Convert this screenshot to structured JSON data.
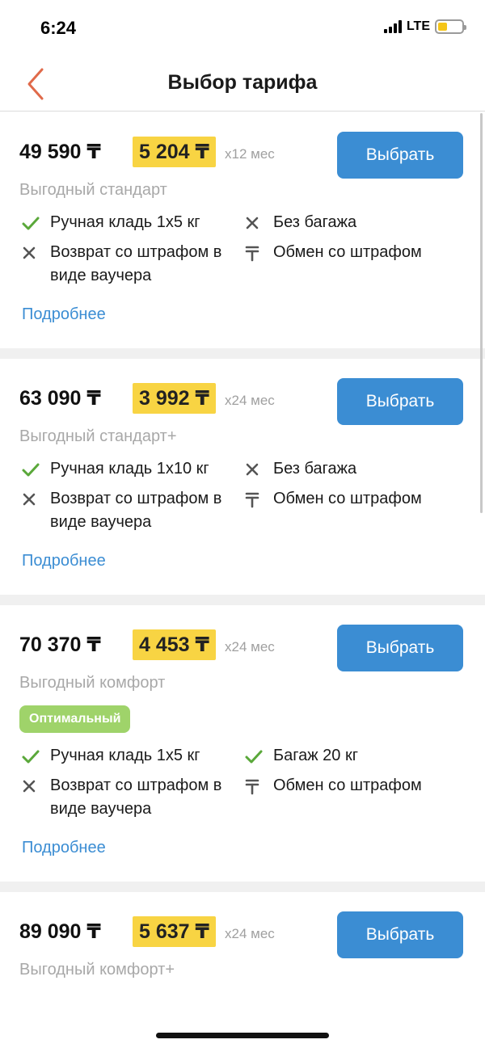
{
  "status": {
    "time": "6:24",
    "network": "LTE"
  },
  "header": {
    "title": "Выбор тарифа"
  },
  "tariffs": [
    {
      "price": "49 590 ₸",
      "monthly": "5 204 ₸",
      "term": "x12 мес",
      "name": "Выгодный стандарт",
      "badge": "",
      "select_label": "Выбрать",
      "features": [
        {
          "icon": "check-icon",
          "text": "Ручная кладь 1x5 кг"
        },
        {
          "icon": "cross-icon",
          "text": "Без багажа"
        },
        {
          "icon": "cross-icon",
          "text": "Возврат со штрафом в виде ваучера"
        },
        {
          "icon": "tenge-icon",
          "text": "Обмен со штрафом"
        }
      ],
      "more_label": "Подробнее"
    },
    {
      "price": "63 090 ₸",
      "monthly": "3 992 ₸",
      "term": "x24 мес",
      "name": "Выгодный стандарт+",
      "badge": "",
      "select_label": "Выбрать",
      "features": [
        {
          "icon": "check-icon",
          "text": "Ручная кладь 1x10 кг"
        },
        {
          "icon": "cross-icon",
          "text": "Без багажа"
        },
        {
          "icon": "cross-icon",
          "text": "Возврат со штрафом в виде ваучера"
        },
        {
          "icon": "tenge-icon",
          "text": "Обмен со штрафом"
        }
      ],
      "more_label": "Подробнее"
    },
    {
      "price": "70 370 ₸",
      "monthly": "4 453 ₸",
      "term": "x24 мес",
      "name": "Выгодный комфорт",
      "badge": "Оптимальный",
      "select_label": "Выбрать",
      "features": [
        {
          "icon": "check-icon",
          "text": "Ручная кладь 1x5 кг"
        },
        {
          "icon": "check-icon",
          "text": "Багаж 20 кг"
        },
        {
          "icon": "cross-icon",
          "text": "Возврат со штрафом в виде ваучера"
        },
        {
          "icon": "tenge-icon",
          "text": "Обмен со штрафом"
        }
      ],
      "more_label": "Подробнее"
    },
    {
      "price": "89 090 ₸",
      "monthly": "5 637 ₸",
      "term": "x24 мес",
      "name": "Выгодный комфорт+",
      "badge": "",
      "select_label": "Выбрать",
      "features": [],
      "more_label": ""
    }
  ],
  "colors": {
    "accent": "#3b8dd3",
    "highlight": "#f8d443",
    "badge": "#9fd36a",
    "check": "#5aa83a",
    "back_arrow": "#e06a4a"
  }
}
